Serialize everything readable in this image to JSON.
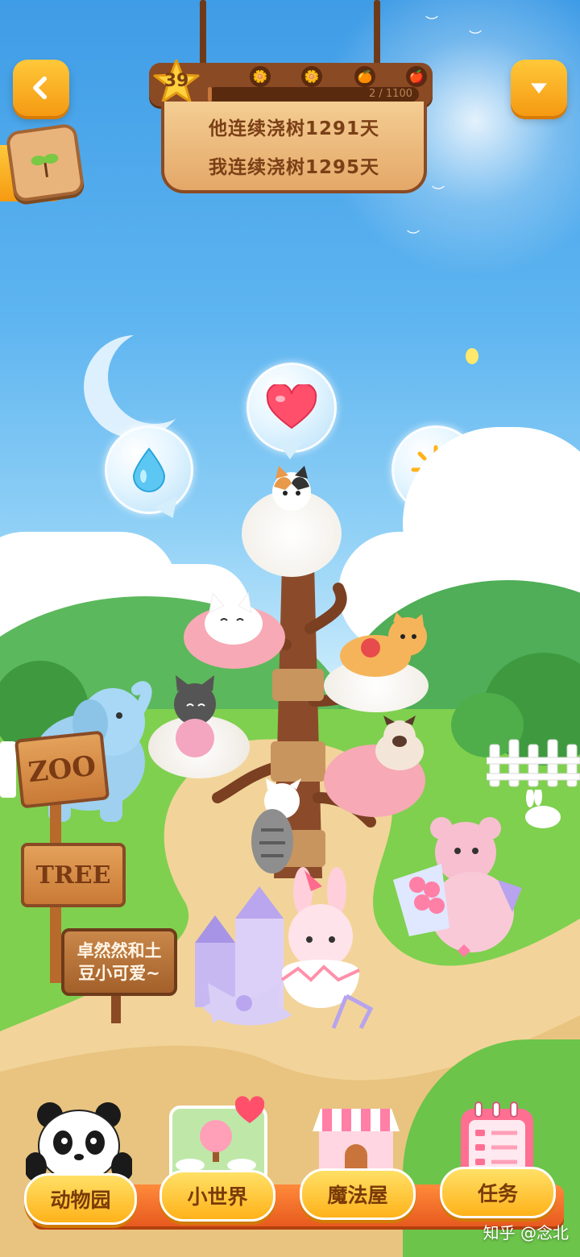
{
  "header": {
    "level": "39",
    "progress_text": "2 / 1100",
    "progress_fraction": 0.002,
    "stage_icons": [
      "flower-bud-icon",
      "flower-icon",
      "orange-fruit-icon",
      "apple-fruit-icon"
    ],
    "partner_streak": "他连续浇树1291天",
    "my_streak": "我连续浇树1295天"
  },
  "actions": {
    "water_icon": "water-drop-icon",
    "love_icon": "heart-icon",
    "sun_icon": "sun-icon"
  },
  "signs": {
    "zoo": "ZOO",
    "tree": "TREE",
    "message": "卓然然和土豆小可爱~"
  },
  "bottom_nav": {
    "items": [
      {
        "label": "动物园",
        "icon": "panda-icon"
      },
      {
        "label": "小世界",
        "icon": "small-world-icon"
      },
      {
        "label": "魔法屋",
        "icon": "magic-house-icon"
      },
      {
        "label": "任务",
        "icon": "task-list-icon"
      }
    ]
  },
  "watermark": "知乎 @念北",
  "colors": {
    "button_orange": "#f59a12",
    "wood": "#8a4a24",
    "sign_text": "#7b3f16"
  }
}
